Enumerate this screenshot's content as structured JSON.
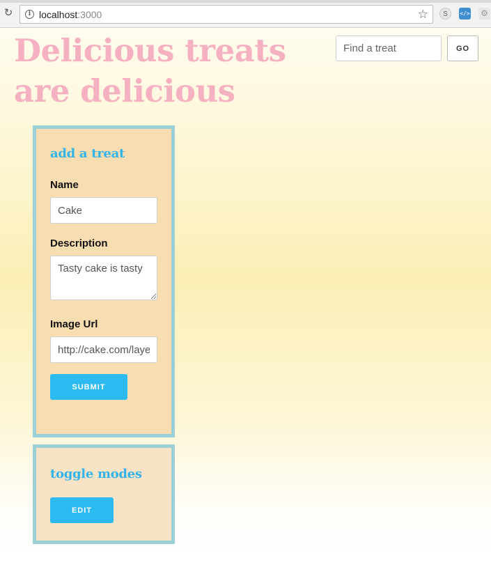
{
  "browser": {
    "url_host": "localhost",
    "url_port": ":3000",
    "reload_icon": "reload-icon",
    "info_icon": "info-icon",
    "star_icon": "bookmark-star-icon",
    "extensions": [
      "S",
      "</>",
      "⚙"
    ]
  },
  "header": {
    "title": "Delicious treats are delicious",
    "search_placeholder": "Find a treat",
    "go_label": "GO"
  },
  "add_treat": {
    "heading": "add a treat",
    "name_label": "Name",
    "name_value": "Cake",
    "description_label": "Description",
    "description_value": "Tasty cake is tasty",
    "image_label": "Image Url",
    "image_value": "http://cake.com/layer-cake.jpg",
    "submit_label": "SUBMIT"
  },
  "toggle_modes": {
    "heading": "toggle modes",
    "edit_label": "EDIT"
  },
  "colors": {
    "title_pink": "#f5b1c1",
    "accent_blue": "#2cbaf1",
    "panel_border": "#9ad0d6",
    "panel_bg": "#f7ddb0"
  }
}
